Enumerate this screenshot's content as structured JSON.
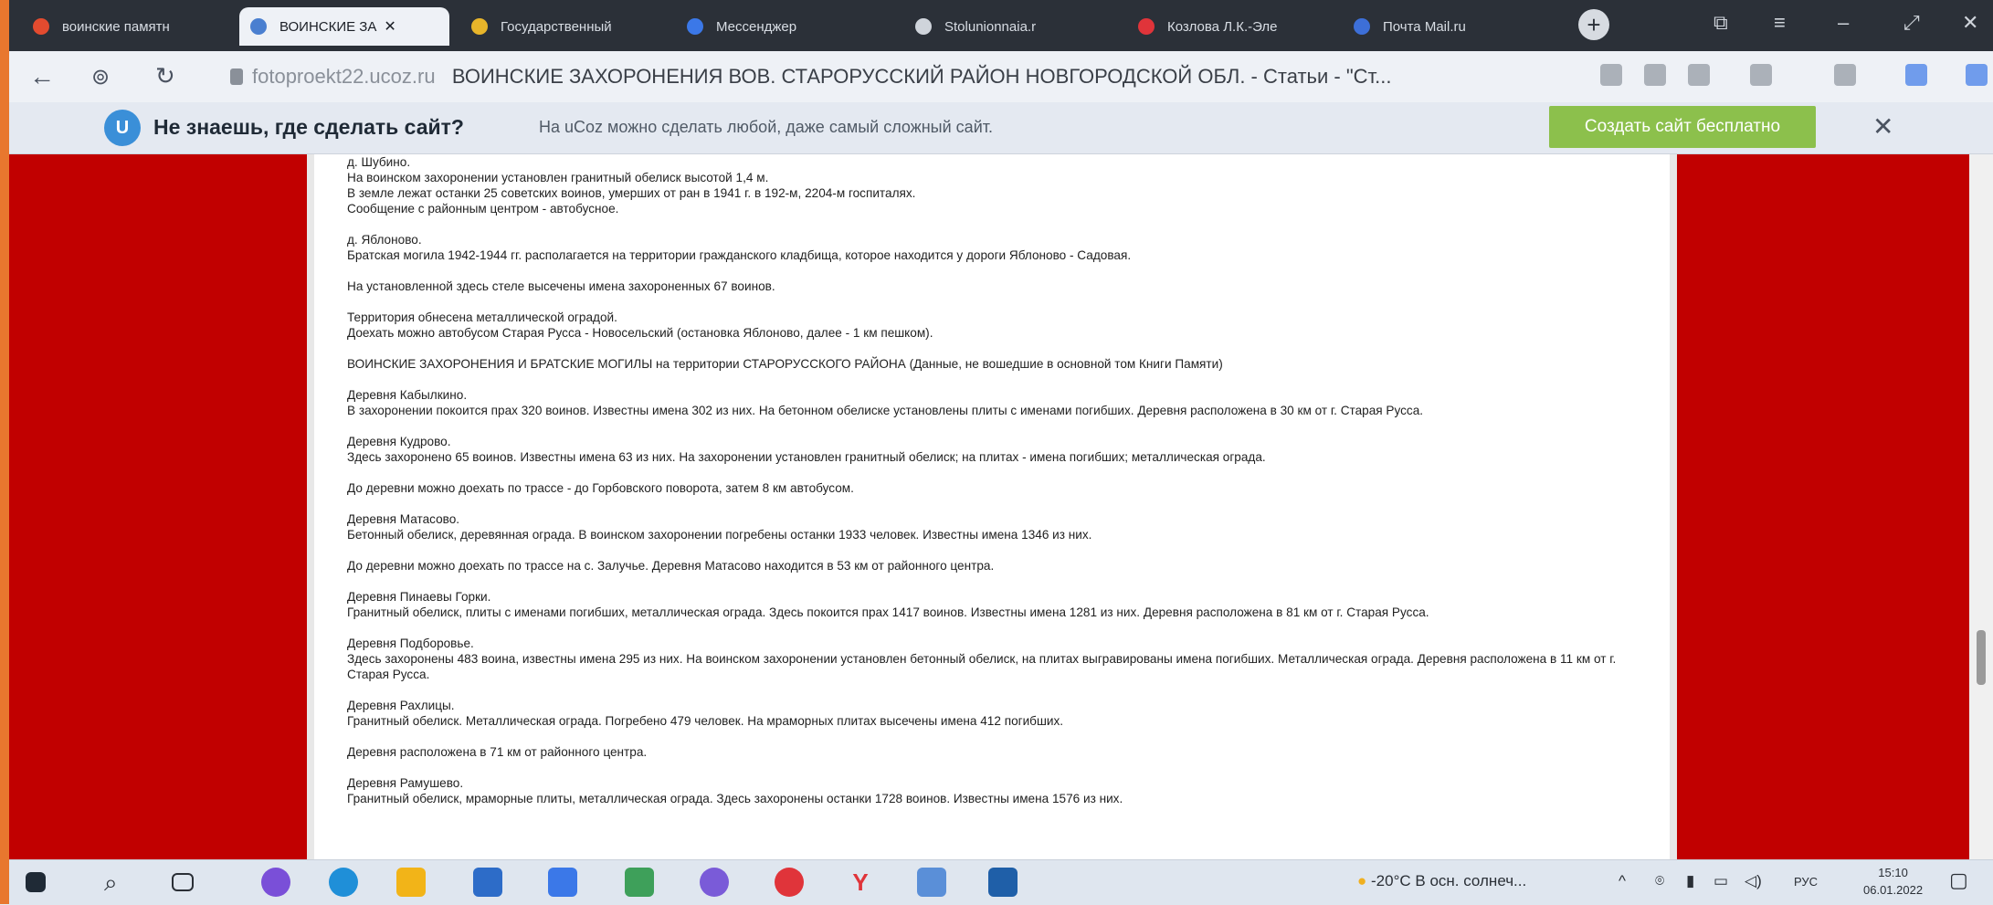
{
  "tabs": [
    {
      "label": "воинские памятн",
      "color": "#e34b2f"
    },
    {
      "label": "ВОИНСКИЕ ЗА",
      "color": "#4a7fd0"
    },
    {
      "label": "Государственный",
      "color": "#e8b52a"
    },
    {
      "label": "Мессенджер",
      "color": "#3b78e8"
    },
    {
      "label": "Stolunionnaia.r",
      "color": "#cfd4db"
    },
    {
      "label": "Козлова Л.К.-Эле",
      "color": "#e0343a"
    },
    {
      "label": "Почта Mail.ru",
      "color": "#3d6fd8"
    }
  ],
  "address": {
    "host": "fotoproekt22.ucoz.ru",
    "title": "ВОИНСКИЕ ЗАХОРОНЕНИЯ ВОВ. СТАРОРУССКИЙ РАЙОН НОВГОРОДСКОЙ ОБЛ. - Статьи - \"Ст..."
  },
  "banner": {
    "logo": "U",
    "title": "Не знаешь, где сделать сайт?",
    "subtitle": "На uCoz можно сделать любой, даже самый сложный сайт.",
    "cta": "Создать сайт бесплатно"
  },
  "paragraphs": [
    "д. Шубино.\nНа воинском захоронении установлен гранитный обелиск высотой 1,4 м.\nВ земле лежат останки 25 советских воинов, умерших от ран в 1941 г. в 192-м, 2204-м госпиталях.\nСообщение с районным центром - автобусное.",
    "д. Яблоново.\nБратская могила 1942-1944 гг. располагается на территории гражданского кладбища, которое находится у дороги Яблоново - Садовая.",
    "На установленной здесь стеле высечены имена захороненных 67 воинов.",
    "Территория обнесена металлической оградой.\nДоехать можно автобусом Старая Русса - Новосельский (остановка Яблоново, далее - 1 км пешком).",
    "ВОИНСКИЕ ЗАХОРОНЕНИЯ И БРАТСКИЕ МОГИЛЫ на территории СТАРОРУССКОГО РАЙОНА (Данные, не вошедшие в основной том Книги Памяти)",
    "Деревня Кабылкино.\nВ захоронении покоится прах 320 воинов. Известны имена 302 из них. На бетонном обелиске установлены плиты с именами погибших. Деревня расположена в 30 км от г. Старая Русса.",
    "Деревня Кудрово.\nЗдесь захоронено 65 воинов. Известны имена 63 из них. На захоронении установлен гранитный обелиск; на плитах - имена погибших; металлическая ограда.",
    "До деревни можно доехать по трассе - до Горбовского поворота, затем 8 км автобусом.",
    "Деревня Матасово.\nБетонный обелиск, деревянная ограда. В воинском захоронении погребены останки 1933 человек. Известны имена 1346 из них.",
    "До деревни можно доехать по трассе на с. Залучье. Деревня Матасово находится в 53 км от районного центра.",
    "Деревня Пинаевы Горки.\nГранитный обелиск, плиты с именами погибших, металлическая ограда. Здесь покоится прах 1417 воинов. Известны имена 1281 из них. Деревня расположена в 81 км от г. Старая Русса.",
    "Деревня Подборовье.\nЗдесь захоронены 483 воина, известны имена 295 из них. На воинском захоронении установлен бетонный обелиск, на плитах выгравированы имена погибших. Металлическая ограда. Деревня расположена в 11 км от г. Старая Русса.",
    "Деревня Рахлицы.\nГранитный обелиск. Металлическая ограда. Погребено 479 человек. На мраморных плитах высечены имена 412 погибших.",
    "Деревня расположена в 71 км от районного центра.",
    "Деревня Рамушево.\nГранитный обелиск, мраморные плиты, металлическая ограда. Здесь захоронены останки 1728 воинов. Известны имена 1576 из них."
  ],
  "taskbar": {
    "weather": "-20°C  В осн. солнеч...",
    "lang": "РУС",
    "time": "15:10",
    "date": "06.01.2022"
  },
  "colors": {
    "page_bg": "#c10000",
    "accent_frame": "#e8772e",
    "cta": "#8cc04c"
  }
}
